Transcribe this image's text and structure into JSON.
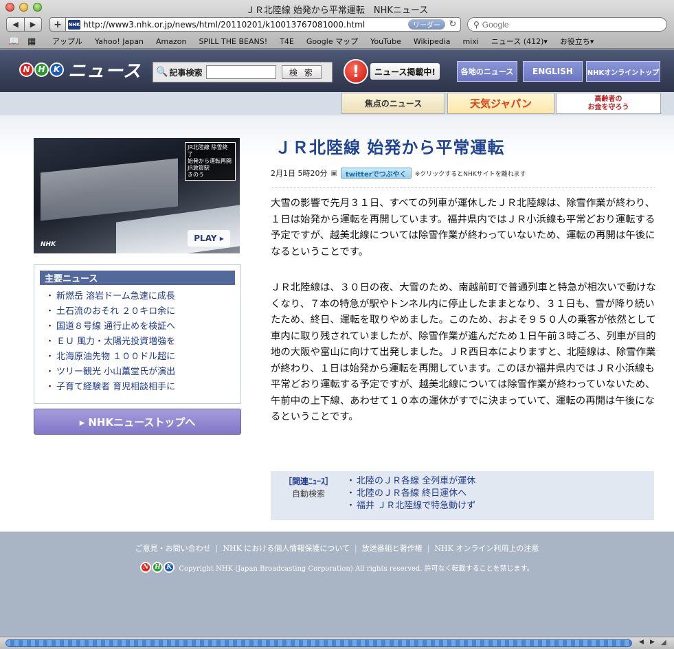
{
  "window": {
    "title": "ＪＲ北陸線 始発から平常運転　NHKニュース"
  },
  "toolbar": {
    "back": "◀",
    "forward": "▶",
    "add": "+",
    "favicon": "NHK",
    "url": "http://www3.nhk.or.jp/news/html/20110201/k10013767081000.html",
    "reader": "リーダー",
    "search_placeholder": "Google"
  },
  "bookmarks": [
    "アップル",
    "Yahoo! Japan",
    "Amazon",
    "SPILL THE BEANS!",
    "T4E",
    "Google マップ",
    "YouTube",
    "Wikipedia",
    "mixi",
    "ニュース (412)▾",
    "お役立ち▾"
  ],
  "header": {
    "logo_letters": [
      "N",
      "H",
      "K"
    ],
    "logo_text": "ニュース",
    "search_label": "記事検索",
    "search_button": "検 索",
    "alert_label": "ニュース掲載中!",
    "tabs": [
      "各地のニュース",
      "ENGLISH",
      "NHKオンライントップ"
    ],
    "banners": {
      "focus": "焦点のニュース",
      "weather": "天気ジャパン",
      "elderly": "高齢者の\nお金を守ろう"
    }
  },
  "video": {
    "caption": "JR北陸線 除雪終了\n始発から運転再開\nJR敦賀駅\nきのう",
    "play": "PLAY ▸",
    "logo": "NHK"
  },
  "main_news": {
    "title": "主要ニュース",
    "items": [
      "新燃岳 溶岩ドーム急速に成長",
      "土石流のおそれ ２０キロ余に",
      "国道８号線 通行止めを検証へ",
      "ＥＵ 風力・太陽光投資増強を",
      "北海原油先物 １００ドル超に",
      "ツリー観光 小山薫堂氏が演出",
      "子育て経験者 育児相談相手に"
    ]
  },
  "top_button": "▸ NHKニューストップへ",
  "article": {
    "headline": "ＪＲ北陸線 始発から平常運転",
    "date": "2月1日 5時20分",
    "twitter": "twitterでつぶやく",
    "twitter_note": "※クリックするとNHKサイトを離れます",
    "para1": "大雪の影響で先月３１日、すべての列車が運休したＪＲ北陸線は、除雪作業が終わり、１日は始発から運転を再開しています。福井県内ではＪＲ小浜線も平常どおり運転する予定ですが、越美北線については除雪作業が終わっていないため、運転の再開は午後になるということです。",
    "para2": "ＪＲ北陸線は、３０日の夜、大雪のため、南越前町で普通列車と特急が相次いで動けなくなり、７本の特急が駅やトンネル内に停止したままとなり、３１日も、雪が降り続いたため、終日、運転を取りやめました。このため、およそ９５０人の乗客が依然として車内に取り残されていましたが、除雪作業が進んだため１日午前３時ごろ、列車が目的地の大阪や富山に向けて出発しました。ＪＲ西日本によりますと、北陸線は、除雪作業が終わり、１日は始発から運転を再開しています。このほか福井県内ではＪＲ小浜線も平常どおり運転する予定ですが、越美北線については除雪作業が終わっていないため、午前中の上下線、あわせて１０本の運休がすでに決まっていて、運転の再開は午後になるということです。"
  },
  "related": {
    "title": "［関連ﾆｭｰｽ］",
    "sub": "自動検索",
    "items": [
      "北陸のＪＲ各線 全列車が運休",
      "北陸のＪＲ各線 終日運休へ",
      "福井 ＪＲ北陸線で特急動けず"
    ]
  },
  "footer": {
    "links": [
      "ご意見・お問い合わせ",
      "NHK における個人情報保護について",
      "放送番組と著作権",
      "NHK オンライン利用上の注意"
    ],
    "copyright": "Copyright NHK (Japan Broadcasting Corporation) All rights reserved. 許可なく転載することを禁じます。"
  },
  "colors": {
    "nhk_red": "#e0201a",
    "nhk_green": "#2a9a2a",
    "nhk_blue": "#1a5ab8",
    "headline": "#1f4394"
  }
}
